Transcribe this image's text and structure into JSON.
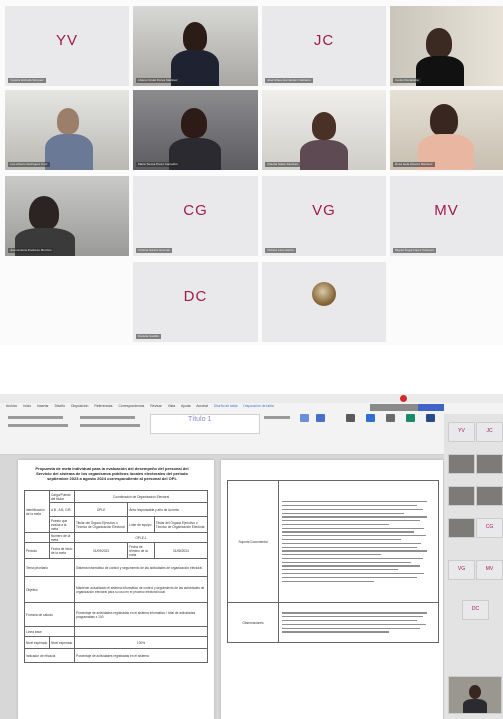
{
  "conference": {
    "tiles": [
      {
        "initials": "YV",
        "name": "Yessica Estrada Vazquez"
      },
      {
        "initials": "",
        "name": "Liliana Cristal Flores Martinez"
      },
      {
        "initials": "JC",
        "name": "José Ulises Hernández Carrasco"
      },
      {
        "initials": "",
        "name": "Carlos Ruvalcaba"
      },
      {
        "initials": "",
        "name": "Luis Alberto Rodríguez Cruz"
      },
      {
        "initials": "",
        "name": "Maria Teresa Pérez Camacho"
      },
      {
        "initials": "",
        "name": "Claudia Salas Sánchez"
      },
      {
        "initials": "",
        "name": "Rosa Isela Álvarez Martínez"
      },
      {
        "initials": "",
        "name": "Juan Antonio Pacheco Monzón"
      },
      {
        "initials": "CG",
        "name": "Cristina García Guzmán"
      },
      {
        "initials": "VG",
        "name": "Victoria Lara García"
      },
      {
        "initials": "MV",
        "name": "Miguel Ángel López Vázquez"
      },
      {
        "initials": "DC",
        "name": "Daniela Castillo"
      },
      {
        "initials": "",
        "name": ""
      }
    ]
  },
  "word": {
    "menu": [
      "Archivo",
      "Inicio",
      "Insertar",
      "Diseño",
      "Disposición",
      "Referencias",
      "Correspondencia",
      "Revisar",
      "Vista",
      "Ayuda",
      "Acrobat",
      "Diseño de tabla",
      "Disposición de tabla"
    ],
    "style_sample": "Título 1",
    "doc_title": "Propuesta de meta individual para la evaluación del desempeño del personal del Servicio del sistema de los organismos públicos locales electorales del periodo septiembre 2023 a agosto 2024 correspondiente al personal del OPL",
    "table_left": {
      "r1_label": "Cargo/Puesto del titular",
      "r1_val": "Coordinación de Organización Electoral",
      "r2_label": "Identificación de la meta",
      "r2_a": "A B , A B, C/B",
      "r2_b": "OPLE",
      "r2_c": "Área responsable y año de la meta",
      "r3_a": "Puesto que evalúa a la meta",
      "r3_b": "Titular del Órgano Ejecutivo o Técnico de Organización Electoral",
      "r3_c": "Líder de equipo",
      "r3_d": "Titular del Órgano Ejecutivo o Técnico de Organización Electoral",
      "r4_label": "Número de la meta",
      "r4_val": "OPLE-1",
      "r5_label": "Periodo",
      "r5_a": "Fecha de inicio de la meta",
      "r5_b": "01/09/2023",
      "r5_c": "Fecha de término de la meta",
      "r5_d": "31/08/2024",
      "r6_label": "Tema prioritario",
      "r6_val": "Sistema informático de control y seguimiento de las actividades de organización electoral",
      "r7_label": "Objetivo",
      "r7_val": "Mantener actualizado el sistema informático de control y seguimiento de las actividades de organización electoral para su uso en el proceso electoral local",
      "r8_label": "Fórmula de cálculo",
      "r8_val": "Porcentaje de actividades registradas en el sistema informático / total de actividades programadas x 100",
      "r9_label": "Línea base",
      "r10_label": "Nivel esperado",
      "r10_a": "Nivel esperado",
      "r10_b": "100%",
      "r11_label": "Indicador de eficacia",
      "r11_val": "Porcentaje de actividades registradas en el sistema"
    },
    "table_right": {
      "row1_label": "Soporte Documental",
      "row2_label": "Observaciones"
    }
  }
}
